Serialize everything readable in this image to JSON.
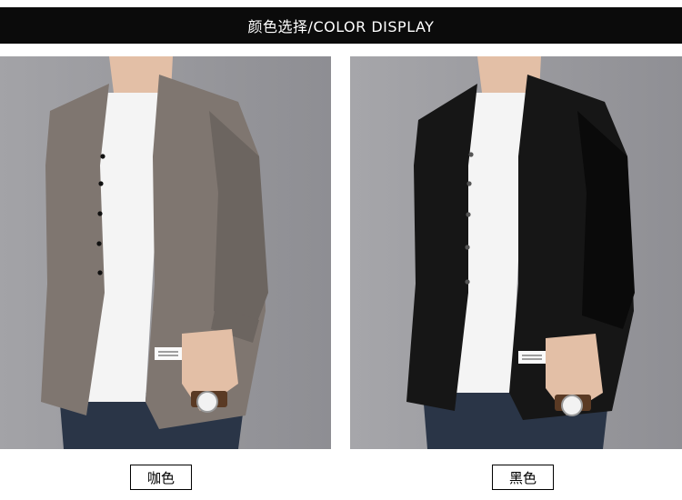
{
  "header": {
    "title": "颜色选择/COLOR DISPLAY"
  },
  "colors": [
    {
      "label": "咖色",
      "sweater_color": "#7f7670",
      "sweater_shade": "#6c6560"
    },
    {
      "label": "黑色",
      "sweater_color": "#161616",
      "sweater_shade": "#0a0a0a"
    }
  ],
  "theme": {
    "background": "#ffffff",
    "header_bg": "#0b0b0b",
    "photo_bg": "#9a9a9e"
  }
}
